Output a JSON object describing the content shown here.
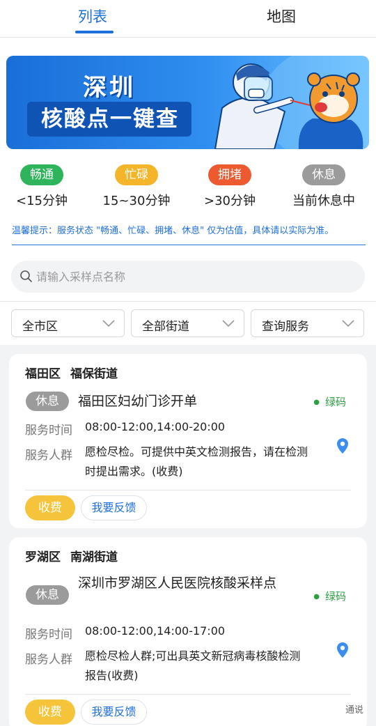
{
  "tabs": {
    "list": "列表",
    "map": "地图"
  },
  "banner": {
    "title": "深圳",
    "subtitle": "核酸点一键查"
  },
  "legend": [
    {
      "pill": "畅通",
      "desc": "<15分钟",
      "color": "#2eb45a"
    },
    {
      "pill": "忙碌",
      "desc": "15~30分钟",
      "color": "#f5b52a"
    },
    {
      "pill": "拥堵",
      "desc": ">30分钟",
      "color": "#ee5a30"
    },
    {
      "pill": "休息",
      "desc": "当前休息中",
      "color": "#9b9b9b"
    }
  ],
  "tip": "温馨提示：服务状态 \"畅通、忙碌、拥堵、休息\" 仅为估值，具体请以实际为准。",
  "search": {
    "placeholder": "请输入采样点名称",
    "value": ""
  },
  "filters": [
    "全市区",
    "全部街道",
    "查询服务"
  ],
  "cards": [
    {
      "district": "福田区",
      "street": "福保街道",
      "status": "休息",
      "name": "福田区妇幼门诊开单",
      "code": "绿码",
      "hours_label": "服务时间",
      "hours": "08:00-12:00,14:00-20:00",
      "people_label": "服务人群",
      "people": "愿检尽检。可提供中英文检测报告，请在检测时提出需求。(收费)",
      "fee": "收费",
      "feedback": "我要反馈"
    },
    {
      "district": "罗湖区",
      "street": "南湖街道",
      "status": "休息",
      "name": "深圳市罗湖区人民医院核酸采样点",
      "code": "绿码",
      "hours_label": "服务时间",
      "hours": "08:00-12:00,14:00-17:00",
      "people_label": "服务人群",
      "people": "愿检尽检人群;可出具英文新冠病毒核酸检测报告(收费)",
      "fee": "收费",
      "feedback": "我要反馈"
    }
  ],
  "watermark": "通说",
  "colors": {
    "accent": "#1e6fd9",
    "green_code": "#2ea043",
    "fee": "#f6c43a"
  }
}
